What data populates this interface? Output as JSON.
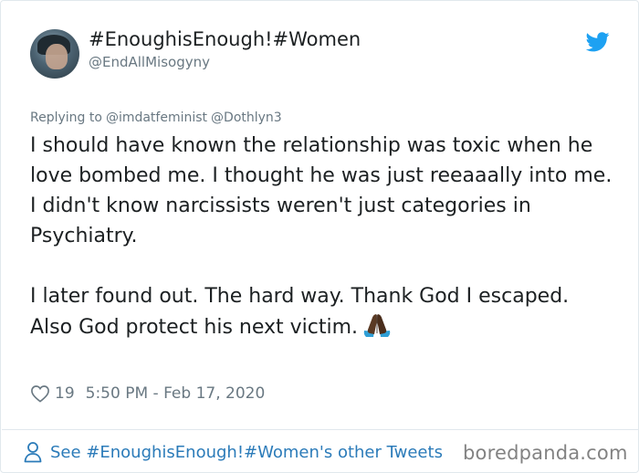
{
  "header": {
    "display_name": "#EnoughisEnough!#Women",
    "handle": "@EndAllMisogyny",
    "platform_icon": "twitter-bird-icon",
    "avatar_icon": "profile-avatar"
  },
  "reply": {
    "prefix": "Replying to",
    "mentions": [
      "@imdatfeminist",
      "@Dothlyn3"
    ]
  },
  "tweet": {
    "paragraph_1": "I should have known the relationship was toxic when he love bombed me. I thought he was just reeaaally into me. I didn't know narcissists weren't just categories in Psychiatry.",
    "paragraph_2_line_1": "I later found out. The hard way. Thank God I escaped.",
    "paragraph_2_line_2": "Also God protect his next victim.",
    "emoji": "folded-hands-emoji"
  },
  "meta": {
    "like_icon": "heart-icon",
    "likes": "19",
    "timestamp": "5:50 PM - Feb 17, 2020"
  },
  "footer": {
    "icon": "person-icon",
    "link_text": "See #EnoughisEnough!#Women's other Tweets"
  },
  "watermark": {
    "text": "boredpanda.com"
  },
  "colors": {
    "link_blue": "#2b7bb9",
    "twitter_blue": "#1da1f2",
    "secondary_gray": "#697882",
    "text_dark": "#1c2022",
    "border": "#e1e8ed"
  }
}
